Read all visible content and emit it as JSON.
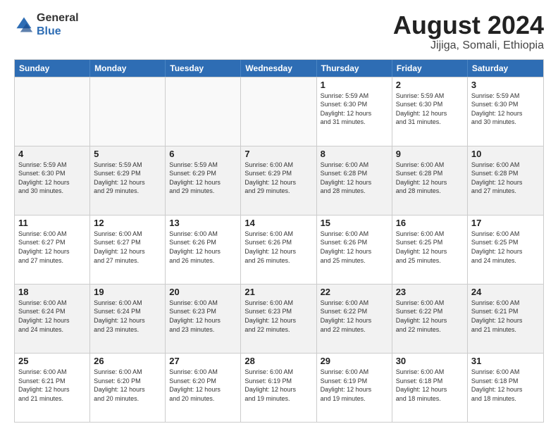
{
  "header": {
    "logo_general": "General",
    "logo_blue": "Blue",
    "month_year": "August 2024",
    "location": "Jijiga, Somali, Ethiopia"
  },
  "days_of_week": [
    "Sunday",
    "Monday",
    "Tuesday",
    "Wednesday",
    "Thursday",
    "Friday",
    "Saturday"
  ],
  "weeks": [
    [
      {
        "day": "",
        "info": ""
      },
      {
        "day": "",
        "info": ""
      },
      {
        "day": "",
        "info": ""
      },
      {
        "day": "",
        "info": ""
      },
      {
        "day": "1",
        "info": "Sunrise: 5:59 AM\nSunset: 6:30 PM\nDaylight: 12 hours\nand 31 minutes."
      },
      {
        "day": "2",
        "info": "Sunrise: 5:59 AM\nSunset: 6:30 PM\nDaylight: 12 hours\nand 31 minutes."
      },
      {
        "day": "3",
        "info": "Sunrise: 5:59 AM\nSunset: 6:30 PM\nDaylight: 12 hours\nand 30 minutes."
      }
    ],
    [
      {
        "day": "4",
        "info": "Sunrise: 5:59 AM\nSunset: 6:30 PM\nDaylight: 12 hours\nand 30 minutes."
      },
      {
        "day": "5",
        "info": "Sunrise: 5:59 AM\nSunset: 6:29 PM\nDaylight: 12 hours\nand 29 minutes."
      },
      {
        "day": "6",
        "info": "Sunrise: 5:59 AM\nSunset: 6:29 PM\nDaylight: 12 hours\nand 29 minutes."
      },
      {
        "day": "7",
        "info": "Sunrise: 6:00 AM\nSunset: 6:29 PM\nDaylight: 12 hours\nand 29 minutes."
      },
      {
        "day": "8",
        "info": "Sunrise: 6:00 AM\nSunset: 6:28 PM\nDaylight: 12 hours\nand 28 minutes."
      },
      {
        "day": "9",
        "info": "Sunrise: 6:00 AM\nSunset: 6:28 PM\nDaylight: 12 hours\nand 28 minutes."
      },
      {
        "day": "10",
        "info": "Sunrise: 6:00 AM\nSunset: 6:28 PM\nDaylight: 12 hours\nand 27 minutes."
      }
    ],
    [
      {
        "day": "11",
        "info": "Sunrise: 6:00 AM\nSunset: 6:27 PM\nDaylight: 12 hours\nand 27 minutes."
      },
      {
        "day": "12",
        "info": "Sunrise: 6:00 AM\nSunset: 6:27 PM\nDaylight: 12 hours\nand 27 minutes."
      },
      {
        "day": "13",
        "info": "Sunrise: 6:00 AM\nSunset: 6:26 PM\nDaylight: 12 hours\nand 26 minutes."
      },
      {
        "day": "14",
        "info": "Sunrise: 6:00 AM\nSunset: 6:26 PM\nDaylight: 12 hours\nand 26 minutes."
      },
      {
        "day": "15",
        "info": "Sunrise: 6:00 AM\nSunset: 6:26 PM\nDaylight: 12 hours\nand 25 minutes."
      },
      {
        "day": "16",
        "info": "Sunrise: 6:00 AM\nSunset: 6:25 PM\nDaylight: 12 hours\nand 25 minutes."
      },
      {
        "day": "17",
        "info": "Sunrise: 6:00 AM\nSunset: 6:25 PM\nDaylight: 12 hours\nand 24 minutes."
      }
    ],
    [
      {
        "day": "18",
        "info": "Sunrise: 6:00 AM\nSunset: 6:24 PM\nDaylight: 12 hours\nand 24 minutes."
      },
      {
        "day": "19",
        "info": "Sunrise: 6:00 AM\nSunset: 6:24 PM\nDaylight: 12 hours\nand 23 minutes."
      },
      {
        "day": "20",
        "info": "Sunrise: 6:00 AM\nSunset: 6:23 PM\nDaylight: 12 hours\nand 23 minutes."
      },
      {
        "day": "21",
        "info": "Sunrise: 6:00 AM\nSunset: 6:23 PM\nDaylight: 12 hours\nand 22 minutes."
      },
      {
        "day": "22",
        "info": "Sunrise: 6:00 AM\nSunset: 6:22 PM\nDaylight: 12 hours\nand 22 minutes."
      },
      {
        "day": "23",
        "info": "Sunrise: 6:00 AM\nSunset: 6:22 PM\nDaylight: 12 hours\nand 22 minutes."
      },
      {
        "day": "24",
        "info": "Sunrise: 6:00 AM\nSunset: 6:21 PM\nDaylight: 12 hours\nand 21 minutes."
      }
    ],
    [
      {
        "day": "25",
        "info": "Sunrise: 6:00 AM\nSunset: 6:21 PM\nDaylight: 12 hours\nand 21 minutes."
      },
      {
        "day": "26",
        "info": "Sunrise: 6:00 AM\nSunset: 6:20 PM\nDaylight: 12 hours\nand 20 minutes."
      },
      {
        "day": "27",
        "info": "Sunrise: 6:00 AM\nSunset: 6:20 PM\nDaylight: 12 hours\nand 20 minutes."
      },
      {
        "day": "28",
        "info": "Sunrise: 6:00 AM\nSunset: 6:19 PM\nDaylight: 12 hours\nand 19 minutes."
      },
      {
        "day": "29",
        "info": "Sunrise: 6:00 AM\nSunset: 6:19 PM\nDaylight: 12 hours\nand 19 minutes."
      },
      {
        "day": "30",
        "info": "Sunrise: 6:00 AM\nSunset: 6:18 PM\nDaylight: 12 hours\nand 18 minutes."
      },
      {
        "day": "31",
        "info": "Sunrise: 6:00 AM\nSunset: 6:18 PM\nDaylight: 12 hours\nand 18 minutes."
      }
    ]
  ],
  "colors": {
    "header_bg": "#2e6db4",
    "accent": "#2e6db4"
  }
}
